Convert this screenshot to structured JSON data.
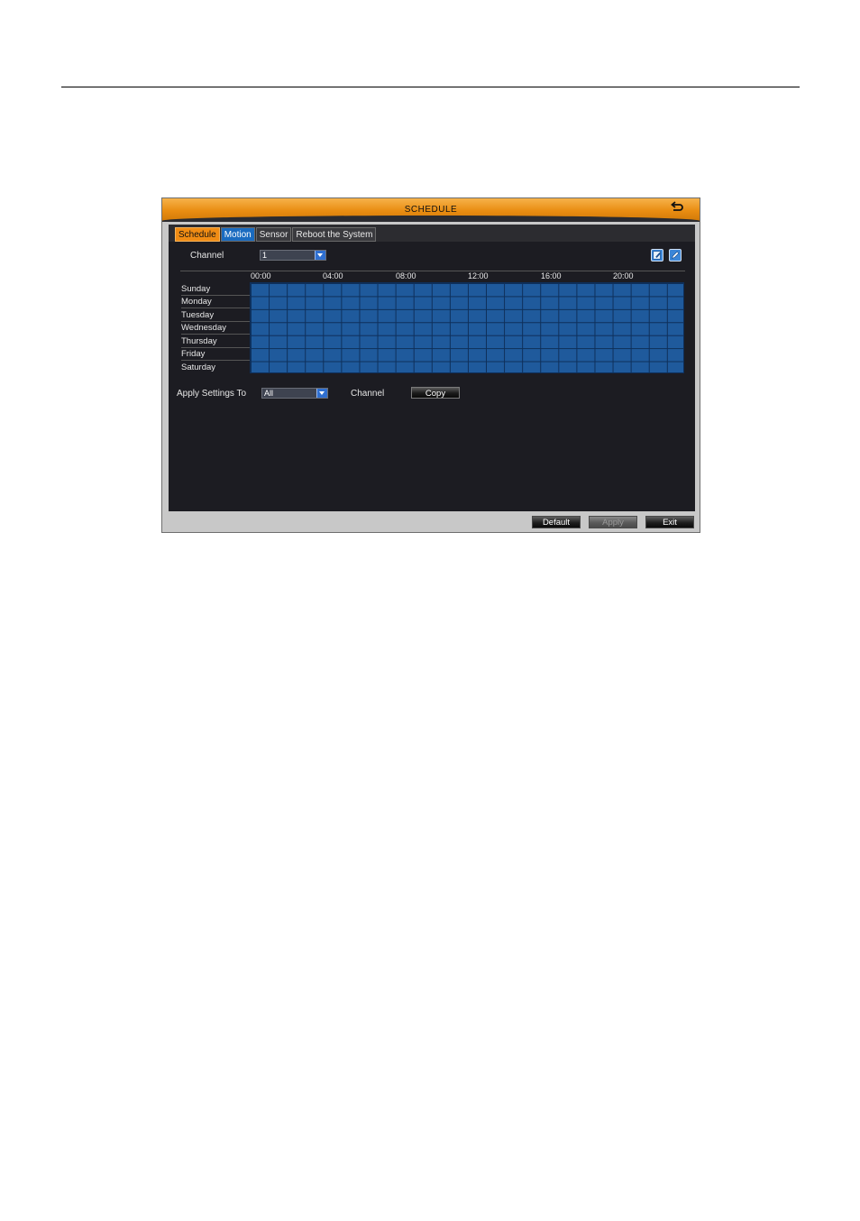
{
  "window": {
    "title": "SCHEDULE",
    "tabs": [
      {
        "label": "Schedule",
        "state": "active"
      },
      {
        "label": "Motion",
        "state": "highlight"
      },
      {
        "label": "Sensor",
        "state": "normal"
      },
      {
        "label": "Reboot the System",
        "state": "normal"
      }
    ],
    "channel_label": "Channel",
    "channel_value": "1",
    "hours": [
      "00:00",
      "04:00",
      "08:00",
      "12:00",
      "16:00",
      "20:00"
    ],
    "days": [
      "Sunday",
      "Monday",
      "Tuesday",
      "Wednesday",
      "Thursday",
      "Friday",
      "Saturday"
    ],
    "apply_label": "Apply Settings To",
    "apply_value": "All",
    "apply_channel_label": "Channel",
    "copy_label": "Copy",
    "buttons": {
      "default": "Default",
      "apply": "Apply",
      "exit": "Exit"
    },
    "colors": {
      "accent": "#f08c14",
      "schedule_fill": "#1f5a9c",
      "motion_tab": "#1a6bc0"
    }
  }
}
